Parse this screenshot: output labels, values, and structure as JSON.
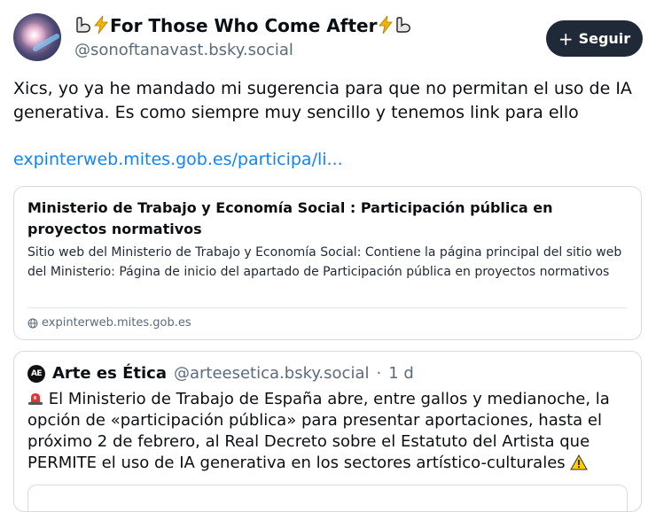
{
  "author": {
    "display_name": "For Those Who Come After",
    "handle": "@sonoftanavast.bsky.social",
    "name_decorations": [
      "flexed-biceps",
      "high-voltage",
      "high-voltage",
      "flexed-biceps"
    ]
  },
  "follow_button": {
    "label": "Seguir"
  },
  "post": {
    "text": "Xics, yo ya he mandado mi sugerencia para que no permitan el uso de IA generativa. Es como siempre muy sencillo y tenemos link para ello",
    "link_text": "expinterweb.mites.gob.es/participa/li..."
  },
  "link_card": {
    "title": "Ministerio de Trabajo y Economía Social : Participación pública en proyectos normativos",
    "description": "Sitio web del Ministerio de Trabajo y Economía Social: Contiene la página principal del sitio web del Ministerio: Página de inicio del apartado de Participación pública en proyectos normativos",
    "domain": "expinterweb.mites.gob.es"
  },
  "quoted_post": {
    "avatar_text": "AE",
    "display_name": "Arte es Ética",
    "handle": "@arteesetica.bsky.social",
    "separator": "·",
    "time": "1 d",
    "text": "El Ministerio de Trabajo de España abre, entre gallos y medianoche, la opción de «participación pública» para presentar aportaciones, hasta el próximo 2 de febrero, al Real Decreto sobre el Estatuto del Artista que PERMITE el uso de IA generativa en los sectores artístico-culturales"
  },
  "colors": {
    "link": "#1083fe",
    "button_bg": "#1f2937",
    "muted": "#5b6b7e",
    "border": "#d4dbe2"
  }
}
